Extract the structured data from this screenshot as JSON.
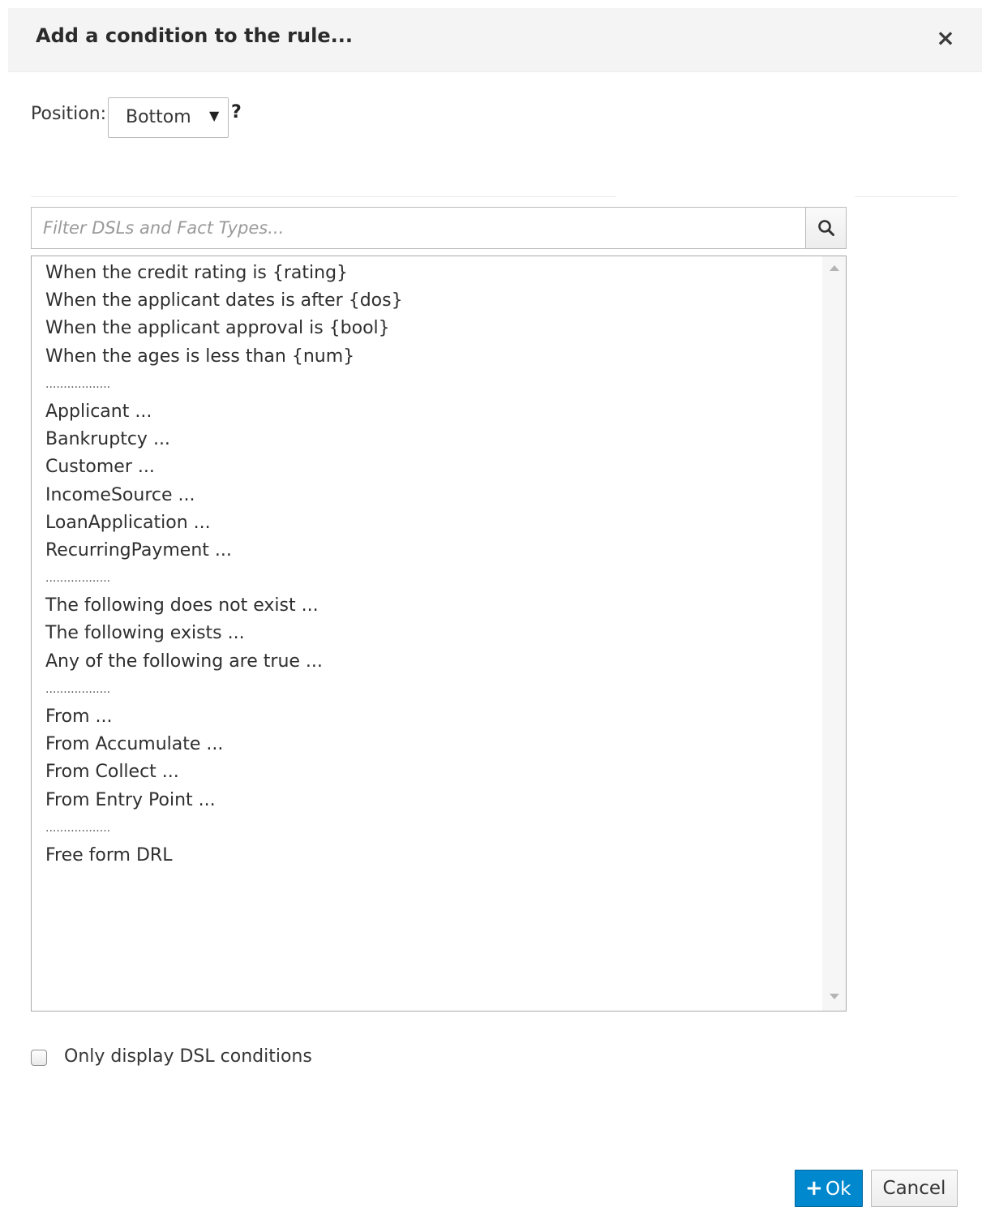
{
  "dialog": {
    "title": "Add a condition to the rule...",
    "close_label": "×"
  },
  "position": {
    "label": "Position:",
    "selected": "Bottom",
    "help_label": "?"
  },
  "filter": {
    "placeholder": "Filter DSLs and Fact Types...",
    "value": "",
    "search_icon": "search-icon"
  },
  "condition_list": {
    "items": [
      "When the credit rating is {rating}",
      "When the applicant dates is after {dos}",
      "When the applicant approval is {bool}",
      "When the ages is less than {num}",
      "..................",
      "Applicant ...",
      "Bankruptcy ...",
      "Customer ...",
      "IncomeSource ...",
      "LoanApplication ...",
      "RecurringPayment ...",
      "..................",
      "The following does not exist ...",
      "The following exists ...",
      "Any of the following are true ...",
      "..................",
      "From ...",
      "From Accumulate ...",
      "From Collect ...",
      "From Entry Point ...",
      "..................",
      "Free form DRL"
    ]
  },
  "dsl_only": {
    "label": "Only display DSL conditions",
    "checked": false
  },
  "footer": {
    "ok_label": "Ok",
    "ok_icon": "plus-icon",
    "cancel_label": "Cancel"
  },
  "colors": {
    "header_bg": "#f4f4f4",
    "primary": "#0088ce",
    "border": "#bbbbbb"
  }
}
